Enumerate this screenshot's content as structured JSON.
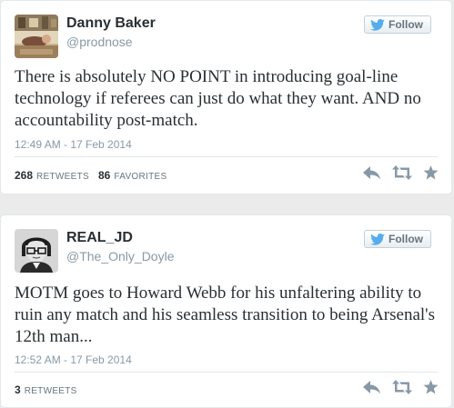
{
  "tweets": [
    {
      "name": "Danny Baker",
      "handle": "@prodnose",
      "follow_label": "Follow",
      "text": "There is absolutely NO POINT in introducing goal-line technology if referees can just do what they want. AND no accountability post-match.",
      "timestamp": "12:49 AM - 17 Feb 2014",
      "retweets_count": "268",
      "retweets_label": "RETWEETS",
      "favorites_count": "86",
      "favorites_label": "FAVORITES",
      "avatar_icon": "photo-avatar"
    },
    {
      "name": "REAL_JD",
      "handle": "@The_Only_Doyle",
      "follow_label": "Follow",
      "text": "MOTM goes to Howard Webb for his unfaltering ability to ruin any match and his seamless transition to being Arsenal's 12th man...",
      "timestamp": "12:52 AM - 17 Feb 2014",
      "retweets_count": "3",
      "retweets_label": "RETWEETS",
      "avatar_icon": "photo-avatar"
    }
  ],
  "icons": {
    "bird": "twitter-bird-icon",
    "reply": "reply-icon",
    "retweet": "retweet-icon",
    "favorite": "star-icon"
  },
  "colors": {
    "brand_blue": "#55acee",
    "action_gray": "#8899a6",
    "text": "#292f33",
    "muted": "#8899a6"
  }
}
